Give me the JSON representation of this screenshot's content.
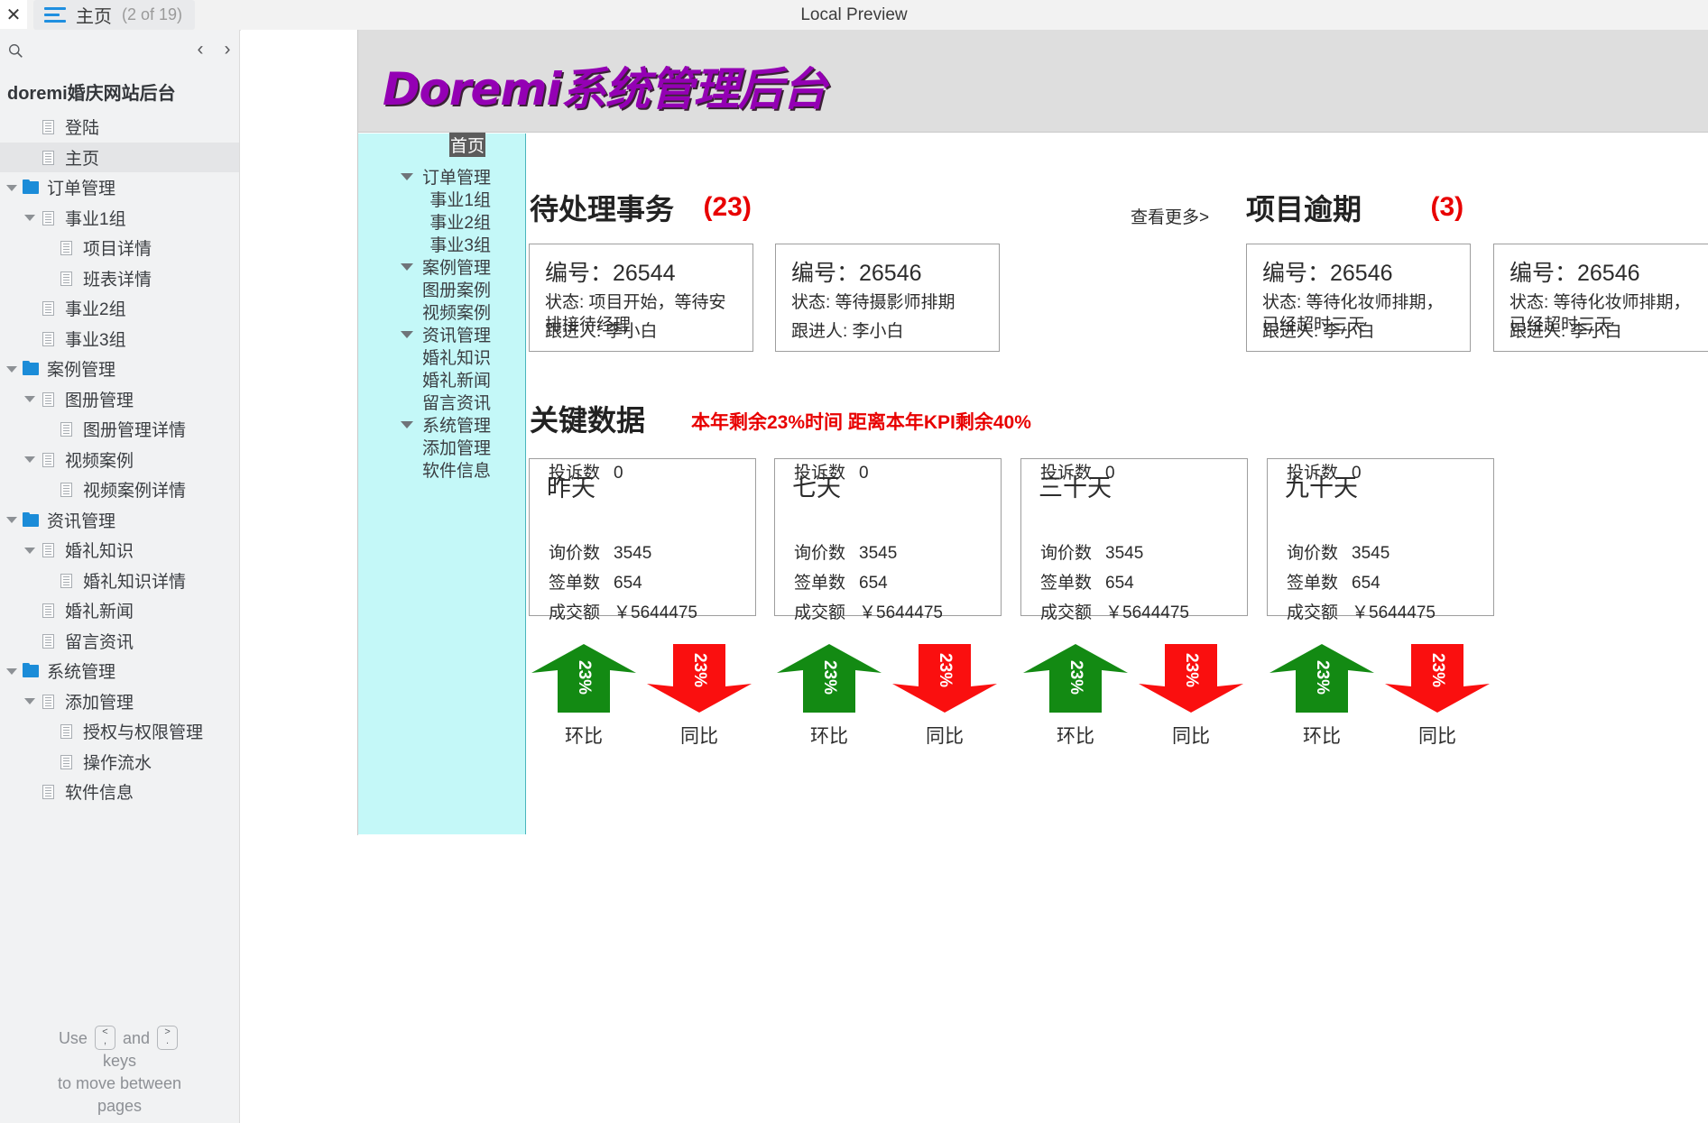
{
  "topbar": {
    "close_icon": "close-icon",
    "menu_icon": "hamburger-icon",
    "tab_title": "主页",
    "tab_count": "(2 of 19)",
    "preview_label": "Local Preview"
  },
  "sidebar": {
    "search_icon": "search-icon",
    "prev_label": "‹",
    "next_label": "›",
    "project_title": "doremi婚庆网站后台",
    "items": [
      {
        "label": "登陆",
        "indent": 1,
        "icon": "doc",
        "caret": false,
        "selected": false
      },
      {
        "label": "主页",
        "indent": 1,
        "icon": "doc",
        "caret": false,
        "selected": true
      },
      {
        "label": "订单管理",
        "indent": 0,
        "icon": "folder",
        "caret": true,
        "selected": false
      },
      {
        "label": "事业1组",
        "indent": 1,
        "icon": "doc",
        "caret": true,
        "selected": false
      },
      {
        "label": "项目详情",
        "indent": 2,
        "icon": "doc",
        "caret": false,
        "selected": false
      },
      {
        "label": "班表详情",
        "indent": 2,
        "icon": "doc",
        "caret": false,
        "selected": false
      },
      {
        "label": "事业2组",
        "indent": 1,
        "icon": "doc",
        "caret": false,
        "selected": false
      },
      {
        "label": "事业3组",
        "indent": 1,
        "icon": "doc",
        "caret": false,
        "selected": false
      },
      {
        "label": "案例管理",
        "indent": 0,
        "icon": "folder",
        "caret": true,
        "selected": false
      },
      {
        "label": "图册管理",
        "indent": 1,
        "icon": "doc",
        "caret": true,
        "selected": false
      },
      {
        "label": "图册管理详情",
        "indent": 2,
        "icon": "doc",
        "caret": false,
        "selected": false
      },
      {
        "label": "视频案例",
        "indent": 1,
        "icon": "doc",
        "caret": true,
        "selected": false
      },
      {
        "label": "视频案例详情",
        "indent": 2,
        "icon": "doc",
        "caret": false,
        "selected": false
      },
      {
        "label": "资讯管理",
        "indent": 0,
        "icon": "folder",
        "caret": true,
        "selected": false
      },
      {
        "label": "婚礼知识",
        "indent": 1,
        "icon": "doc",
        "caret": true,
        "selected": false
      },
      {
        "label": "婚礼知识详情",
        "indent": 2,
        "icon": "doc",
        "caret": false,
        "selected": false
      },
      {
        "label": "婚礼新闻",
        "indent": 1,
        "icon": "doc",
        "caret": false,
        "selected": false
      },
      {
        "label": "留言资讯",
        "indent": 1,
        "icon": "doc",
        "caret": false,
        "selected": false
      },
      {
        "label": "系统管理",
        "indent": 0,
        "icon": "folder",
        "caret": true,
        "selected": false
      },
      {
        "label": "添加管理",
        "indent": 1,
        "icon": "doc",
        "caret": true,
        "selected": false
      },
      {
        "label": "授权与权限管理",
        "indent": 2,
        "icon": "doc",
        "caret": false,
        "selected": false
      },
      {
        "label": "操作流水",
        "indent": 2,
        "icon": "doc",
        "caret": false,
        "selected": false
      },
      {
        "label": "软件信息",
        "indent": 1,
        "icon": "doc",
        "caret": false,
        "selected": false
      }
    ],
    "footer": {
      "use": "Use",
      "and": "and",
      "key_prev_upper": "<",
      "key_prev_lower": ",",
      "key_next_upper": ">",
      "key_next_lower": ".",
      "line2": "keys",
      "line3": "to move between",
      "line4": "pages"
    }
  },
  "app": {
    "logo": "Doremi系统管理后台",
    "inner_nav": [
      {
        "label": "首页",
        "type": "home"
      },
      {
        "label": "订单管理",
        "type": "group"
      },
      {
        "label": "事业1组",
        "type": "child"
      },
      {
        "label": "事业2组",
        "type": "child"
      },
      {
        "label": "事业3组",
        "type": "child"
      },
      {
        "label": "案例管理",
        "type": "group"
      },
      {
        "label": "图册案例",
        "type": "child"
      },
      {
        "label": "视频案例",
        "type": "child"
      },
      {
        "label": "资讯管理",
        "type": "group"
      },
      {
        "label": "婚礼知识",
        "type": "child"
      },
      {
        "label": "婚礼新闻",
        "type": "child"
      },
      {
        "label": "留言资讯",
        "type": "child"
      },
      {
        "label": "系统管理",
        "type": "group"
      },
      {
        "label": "添加管理",
        "type": "child"
      },
      {
        "label": "软件信息",
        "type": "child"
      }
    ],
    "todo": {
      "title": "待处理事务",
      "count": "(23)",
      "more": "查看更多>",
      "cards": [
        {
          "id": "编号：26544",
          "status": "状态: 项目开始，等待安排接待经理",
          "follower": "跟进人: 李小白"
        },
        {
          "id": "编号：26546",
          "status": "状态: 等待摄影师排期",
          "follower": "跟进人: 李小白"
        }
      ]
    },
    "overdue": {
      "title": "项目逾期",
      "count": "(3)",
      "cards": [
        {
          "id": "编号：26546",
          "status": "状态: 等待化妆师排期，已经超时三天",
          "follower": "跟进人: 李小白"
        },
        {
          "id": "编号：26546",
          "status": "状态: 等待化妆师排期，已经超时三天",
          "follower": "跟进人: 李小白"
        }
      ]
    },
    "key_data": {
      "title": "关键数据",
      "subtitle": "本年剩余23%时间  距离本年KPI剩余40%",
      "labels": {
        "inquiry": "询价数",
        "signed": "签单数",
        "amount": "成交额",
        "complaint": "投诉数"
      },
      "cards": [
        {
          "period": "昨天",
          "inquiry": "3545",
          "signed": "654",
          "amount": "￥5644475",
          "complaint": "0"
        },
        {
          "period": "七天",
          "inquiry": "3545",
          "signed": "654",
          "amount": "￥5644475",
          "complaint": "0"
        },
        {
          "period": "三十天",
          "inquiry": "3545",
          "signed": "654",
          "amount": "￥5644475",
          "complaint": "0"
        },
        {
          "period": "九十天",
          "inquiry": "3545",
          "signed": "654",
          "amount": "￥5644475",
          "complaint": "0"
        }
      ],
      "trends": [
        {
          "up_pct": "23%",
          "up_label": "环比",
          "down_pct": "23%",
          "down_label": "同比"
        },
        {
          "up_pct": "23%",
          "up_label": "环比",
          "down_pct": "23%",
          "down_label": "同比"
        },
        {
          "up_pct": "23%",
          "up_label": "环比",
          "down_pct": "23%",
          "down_label": "同比"
        },
        {
          "up_pct": "23%",
          "up_label": "环比",
          "down_pct": "23%",
          "down_label": "同比"
        }
      ]
    },
    "colors": {
      "logo": "#9400b4",
      "accent_red": "#e80000",
      "inner_nav_bg": "#c4f8f8",
      "trend_up": "#138a13",
      "trend_down": "#fa0f0f"
    }
  }
}
